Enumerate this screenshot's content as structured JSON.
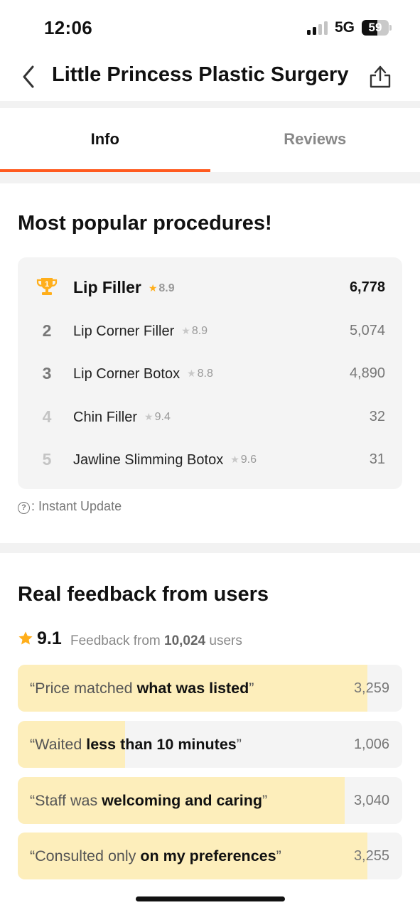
{
  "status_bar": {
    "time": "12:06",
    "network": "5G",
    "battery": "59",
    "battery_level": 0.59
  },
  "header": {
    "title": "Little Princess Plastic Surgery"
  },
  "tabs": [
    {
      "label": "Info",
      "active": true
    },
    {
      "label": "Reviews",
      "active": false
    }
  ],
  "popular": {
    "title": "Most popular procedures!",
    "items": [
      {
        "rank": "1",
        "name": "Lip Filler",
        "rating": "8.9",
        "count": "6,778"
      },
      {
        "rank": "2",
        "name": "Lip Corner Filler",
        "rating": "8.9",
        "count": "5,074"
      },
      {
        "rank": "3",
        "name": "Lip Corner Botox",
        "rating": "8.8",
        "count": "4,890"
      },
      {
        "rank": "4",
        "name": "Chin Filler",
        "rating": "9.4",
        "count": "32"
      },
      {
        "rank": "5",
        "name": "Jawline Slimming Botox",
        "rating": "9.6",
        "count": "31"
      }
    ],
    "note": ": Instant Update"
  },
  "feedback": {
    "title": "Real feedback from users",
    "score": "9.1",
    "text_before": "Feedback from",
    "users": "10,024",
    "text_after": "users",
    "items": [
      {
        "plain": "“Price matched ",
        "bold": "what was listed",
        "close": "”",
        "count": "3,259",
        "share": 0.91
      },
      {
        "plain": "“Waited ",
        "bold": "less than 10 minutes",
        "close": "”",
        "count": "1,006",
        "share": 0.28
      },
      {
        "plain": "“Staff was ",
        "bold": "welcoming and caring",
        "close": "”",
        "count": "3,040",
        "share": 0.85
      },
      {
        "plain": "“Consulted only ",
        "bold": "on my preferences",
        "close": "”",
        "count": "3,255",
        "share": 0.91
      }
    ]
  },
  "colors": {
    "accent": "#ff5a1f",
    "star": "#ffae1a",
    "bar_fill": "#fdeebb",
    "card_bg": "#f4f4f4"
  },
  "icons": {
    "back": "chevron-left-icon",
    "share": "share-icon",
    "top_rank": "trophy-icon",
    "rating": "star-icon",
    "note": "question-circle-icon"
  }
}
